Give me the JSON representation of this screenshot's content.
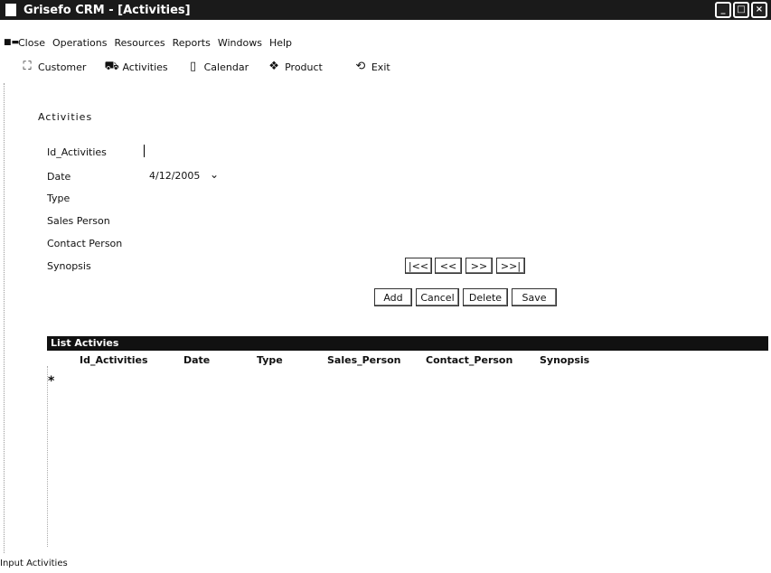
{
  "window": {
    "title": "Grisefo CRM - [Activities]",
    "controls": [
      "minimize",
      "maximize",
      "close"
    ]
  },
  "menubar": {
    "items": [
      {
        "label": "Close"
      },
      {
        "label": "Operations"
      },
      {
        "label": "Resources"
      },
      {
        "label": "Reports"
      },
      {
        "label": "Windows"
      },
      {
        "label": "Help"
      }
    ]
  },
  "toolbar": {
    "items": [
      {
        "label": "Customer",
        "icon": "customer-icon"
      },
      {
        "label": "Activities",
        "icon": "activities-icon"
      },
      {
        "label": "Calendar",
        "icon": "calendar-icon"
      },
      {
        "label": "Product",
        "icon": "product-icon"
      },
      {
        "label": "Exit",
        "icon": "exit-icon"
      }
    ]
  },
  "form": {
    "title": "Activities",
    "fields": {
      "id_activities": {
        "label": "Id_Activities",
        "value": ""
      },
      "date": {
        "label": "Date",
        "value": "4/12/2005"
      },
      "type": {
        "label": "Type",
        "value": ""
      },
      "sales_person": {
        "label": "Sales Person",
        "value": ""
      },
      "contact_person": {
        "label": "Contact Person",
        "value": ""
      },
      "synopsis": {
        "label": "Synopsis",
        "value": ""
      }
    },
    "nav_buttons": {
      "first": "|<<",
      "prev": "<<",
      "next": ">>",
      "last": ">>|"
    },
    "action_buttons": {
      "add": "Add",
      "cancel": "Cancel",
      "delete": "Delete",
      "save": "Save"
    }
  },
  "list": {
    "title": "List Activies",
    "columns": [
      "Id_Activities",
      "Date",
      "Type",
      "Sales_Person",
      "Contact_Person",
      "Synopsis"
    ],
    "new_row_marker": "*"
  },
  "status": {
    "text": "Input Activities"
  }
}
